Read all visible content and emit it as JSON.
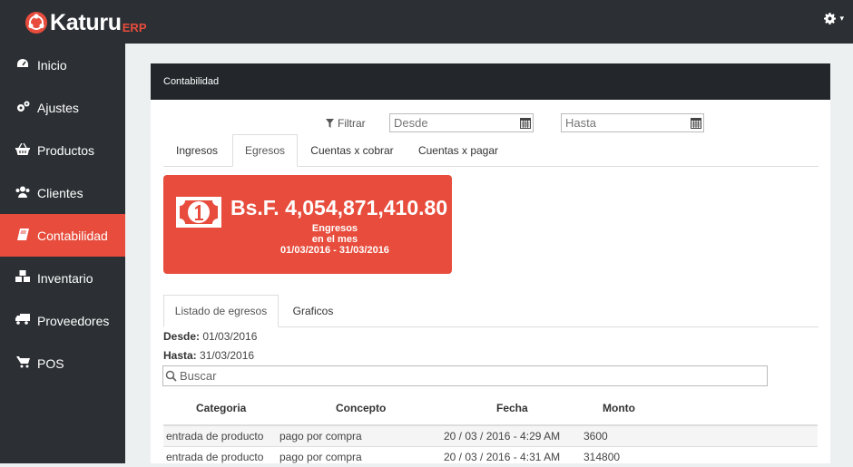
{
  "app": {
    "brand_name": "Katuru",
    "brand_suffix": "ERP",
    "accent": "#e74c3c"
  },
  "topbar": {
    "settings_icon": "gear-icon",
    "caret": "▾"
  },
  "sidebar": {
    "items": [
      {
        "label": "Inicio",
        "icon": "dashboard-icon",
        "active": false
      },
      {
        "label": "Ajustes",
        "icon": "cogs-icon",
        "active": false
      },
      {
        "label": "Productos",
        "icon": "basket-icon",
        "active": false
      },
      {
        "label": "Clientes",
        "icon": "users-icon",
        "active": false
      },
      {
        "label": "Contabilidad",
        "icon": "book-icon",
        "active": true
      },
      {
        "label": "Inventario",
        "icon": "cubes-icon",
        "active": false
      },
      {
        "label": "Proveedores",
        "icon": "truck-icon",
        "active": false
      },
      {
        "label": "POS",
        "icon": "cart-icon",
        "active": false
      }
    ]
  },
  "panel": {
    "title": "Contabilidad"
  },
  "filter": {
    "label": "Filtrar",
    "desde_placeholder": "Desde",
    "hasta_placeholder": "Hasta"
  },
  "tabs": [
    {
      "label": "Ingresos",
      "active": false
    },
    {
      "label": "Egresos",
      "active": true
    },
    {
      "label": "Cuentas x cobrar",
      "active": false
    },
    {
      "label": "Cuentas x pagar",
      "active": false
    }
  ],
  "stat": {
    "amount": "Bs.F. 4,054,871,410.80",
    "line1": "Engresos",
    "line2": "en el mes",
    "line3": "01/03/2016 - 31/03/2016"
  },
  "subtabs": [
    {
      "label": "Listado de egresos",
      "active": true
    },
    {
      "label": "Graficos",
      "active": false
    }
  ],
  "range": {
    "desde_label": "Desde:",
    "desde_value": " 01/03/2016",
    "hasta_label": "Hasta:",
    "hasta_value": " 31/03/2016"
  },
  "search": {
    "placeholder": "Buscar"
  },
  "table": {
    "headers": [
      "Categoria",
      "Concepto",
      "Fecha",
      "Monto"
    ],
    "rows": [
      [
        "entrada de producto",
        "pago por compra",
        "20 / 03 / 2016 - 4:29 AM",
        "3600"
      ],
      [
        "entrada de producto",
        "pago por compra",
        "20 / 03 / 2016 - 4:31 AM",
        "314800"
      ]
    ]
  }
}
